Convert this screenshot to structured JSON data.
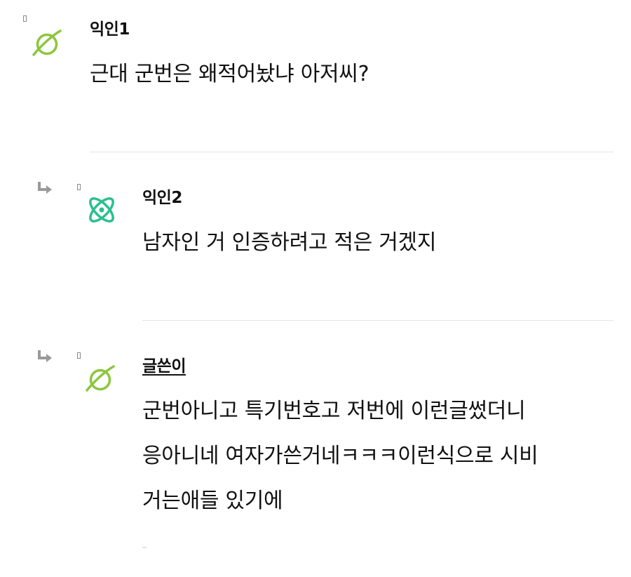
{
  "comments": [
    {
      "nickname": "익인1",
      "is_reply": false,
      "is_author": false,
      "avatar_icon": "planet-icon",
      "avatar_color": "#8cc63f",
      "lines": [
        "근대 군번은 왜적어놨냐 아저씨?"
      ]
    },
    {
      "nickname": "익인2",
      "is_reply": true,
      "is_author": false,
      "avatar_icon": "atom-icon",
      "avatar_color": "#2bbf8f",
      "lines": [
        "남자인 거 인증하려고 적은 거겠지"
      ]
    },
    {
      "nickname": "글쓴이",
      "is_reply": true,
      "is_author": true,
      "avatar_icon": "planet-icon",
      "avatar_color": "#8cc63f",
      "lines": [
        "군번아니고 특기번호고 저번에 이런글썼더니",
        "응아니네 여자가쓴거네ㅋㅋㅋ이런식으로 시비",
        "거는애들 있기에"
      ]
    }
  ],
  "icons": {
    "reply_arrow": "reply-arrow-icon",
    "marker": "comment-marker-icon"
  },
  "colors": {
    "text": "#111111",
    "divider": "#e4e4e4",
    "reply_arrow": "#9a9a9a",
    "marker": "#8a8a8a"
  }
}
